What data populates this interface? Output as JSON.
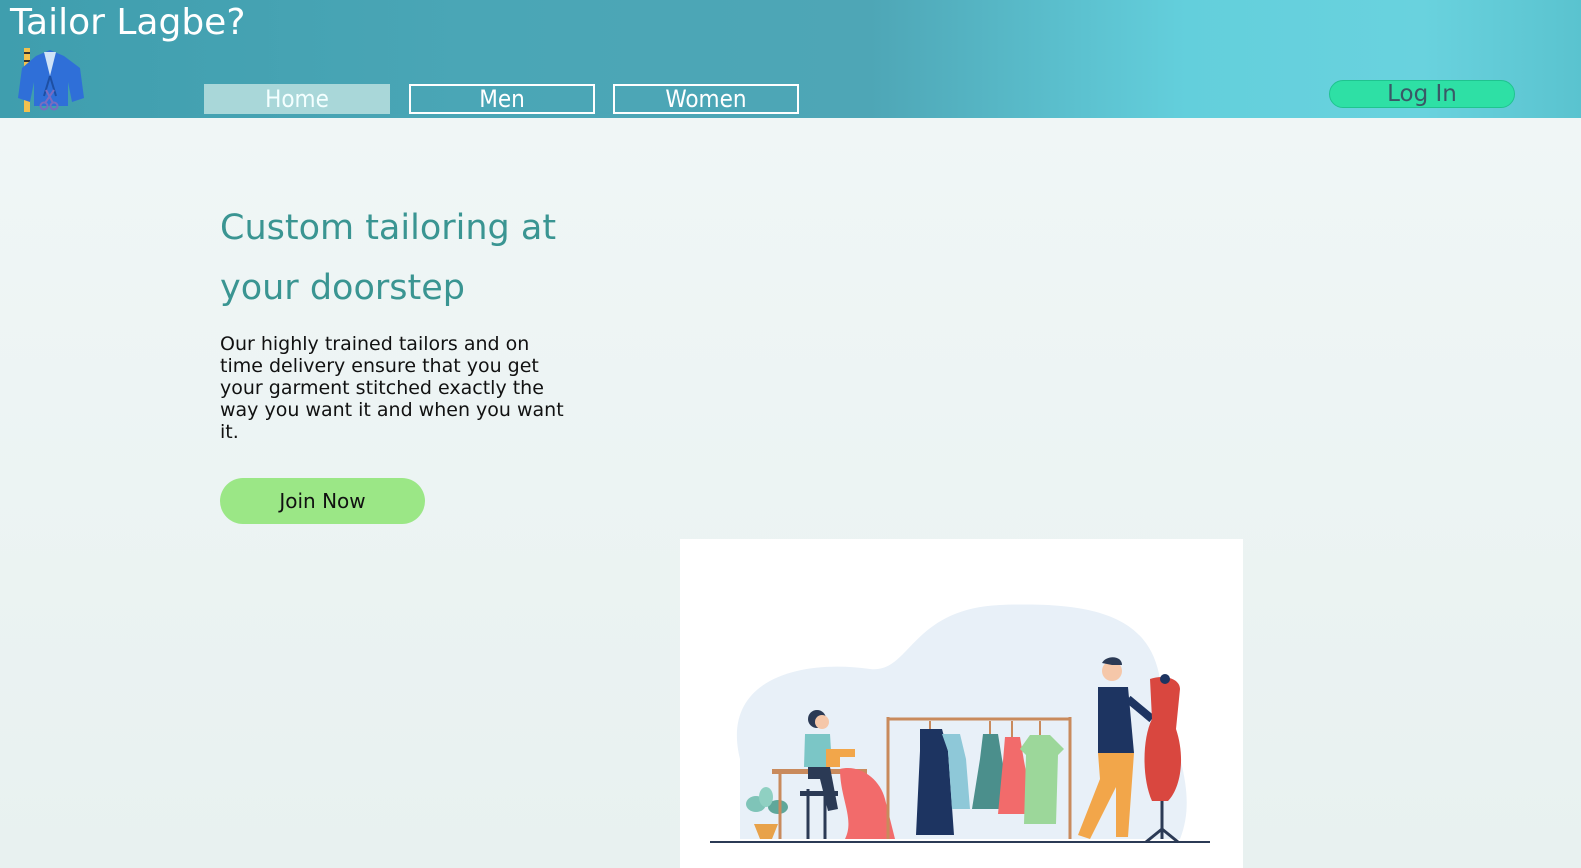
{
  "header": {
    "brand_title": "Tailor Lagbe?",
    "logo_icon": "tailor-jacket-icon",
    "nav": [
      {
        "label": "Home",
        "active": true
      },
      {
        "label": "Men",
        "active": false
      },
      {
        "label": "Women",
        "active": false
      }
    ],
    "login_label": "Log In"
  },
  "hero": {
    "title": "Custom tailoring at your doorstep",
    "description": "Our highly trained tailors and on time delivery ensure that you get your garment stitched exactly the way you want it and when you want it.",
    "cta_label": "Join Now"
  },
  "illustration": {
    "icon": "tailor-shop-illustration"
  },
  "colors": {
    "header_start": "#3f9eae",
    "header_end": "#69d2de",
    "login_bg": "#2ee0a5",
    "cta_bg": "#9be786",
    "title_color": "#3a9592"
  }
}
